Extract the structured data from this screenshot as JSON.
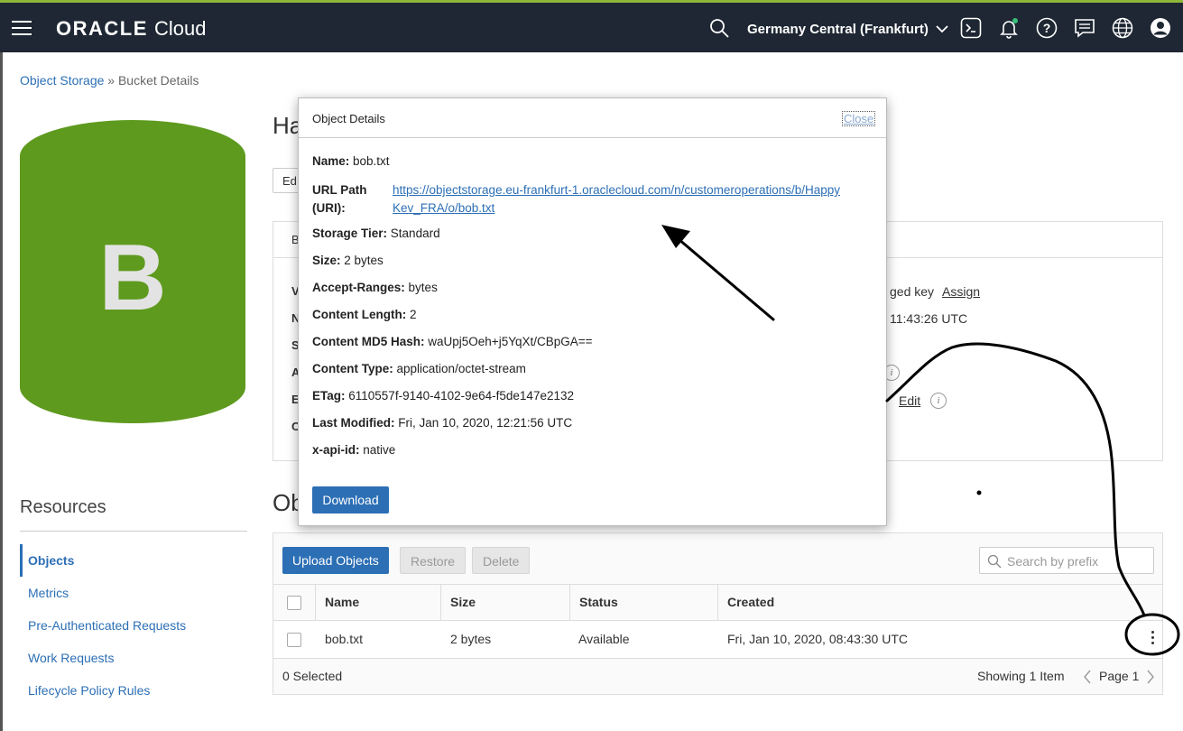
{
  "header": {
    "brand_bold": "ORACLE",
    "brand_light": "Cloud",
    "region": "Germany Central (Frankfurt)"
  },
  "breadcrumb": {
    "root": "Object Storage",
    "separator": " » ",
    "current": "Bucket Details"
  },
  "bucket": {
    "icon_letter": "B",
    "icon_color": "#5e9a1e",
    "name_peek": "Ha",
    "edit_peek": "Ed",
    "details_tab_peek": "B",
    "row_peeks": [
      "V",
      "N",
      "S",
      "A",
      "E",
      "C"
    ],
    "managed_key_text": "ged key",
    "assign_link": "Assign",
    "created_text": "11:43:26 UTC",
    "edit_link": "Edit"
  },
  "resources": {
    "title": "Resources",
    "items": [
      {
        "label": "Objects",
        "active": true
      },
      {
        "label": "Metrics",
        "active": false
      },
      {
        "label": "Pre-Authenticated Requests",
        "active": false
      },
      {
        "label": "Work Requests",
        "active": false
      },
      {
        "label": "Lifecycle Policy Rules",
        "active": false
      }
    ]
  },
  "objects": {
    "title_peek": "Ob",
    "upload_label": "Upload Objects",
    "restore_label": "Restore",
    "delete_label": "Delete",
    "search_placeholder": "Search by prefix",
    "columns": [
      "Name",
      "Size",
      "Status",
      "Created"
    ],
    "rows": [
      {
        "name": "bob.txt",
        "size": "2 bytes",
        "status": "Available",
        "created": "Fri, Jan 10, 2020, 08:43:30 UTC"
      }
    ],
    "selected_text": "0 Selected",
    "showing_text": "Showing 1 Item",
    "page_text": "Page 1"
  },
  "modal": {
    "title": "Object Details",
    "close_label": "Close",
    "uri_label_line1": "URL Path",
    "uri_label_line2": "(URI):",
    "uri_value": "https://objectstorage.eu-frankfurt-1.oraclecloud.com/n/customeroperations/b/HappyKev_FRA/o/bob.txt",
    "fields": [
      {
        "label": "Name:",
        "value": "bob.txt"
      },
      {
        "label": "Storage Tier:",
        "value": "Standard"
      },
      {
        "label": "Size:",
        "value": "2 bytes"
      },
      {
        "label": "Accept-Ranges:",
        "value": "bytes"
      },
      {
        "label": "Content Length:",
        "value": "2"
      },
      {
        "label": "Content MD5 Hash:",
        "value": "waUpj5Oeh+j5YqXt/CBpGA=="
      },
      {
        "label": "Content Type:",
        "value": "application/octet-stream"
      },
      {
        "label": "ETag:",
        "value": "6110557f-9140-4102-9e64-f5de147e2132"
      },
      {
        "label": "Last Modified:",
        "value": "Fri, Jan 10, 2020, 12:21:56 UTC"
      },
      {
        "label": "x-api-id:",
        "value": "native"
      }
    ],
    "download_label": "Download"
  },
  "colors": {
    "topbar": "#1e2733",
    "link": "#2c6fb5",
    "primary_button": "#2c6fb5"
  }
}
